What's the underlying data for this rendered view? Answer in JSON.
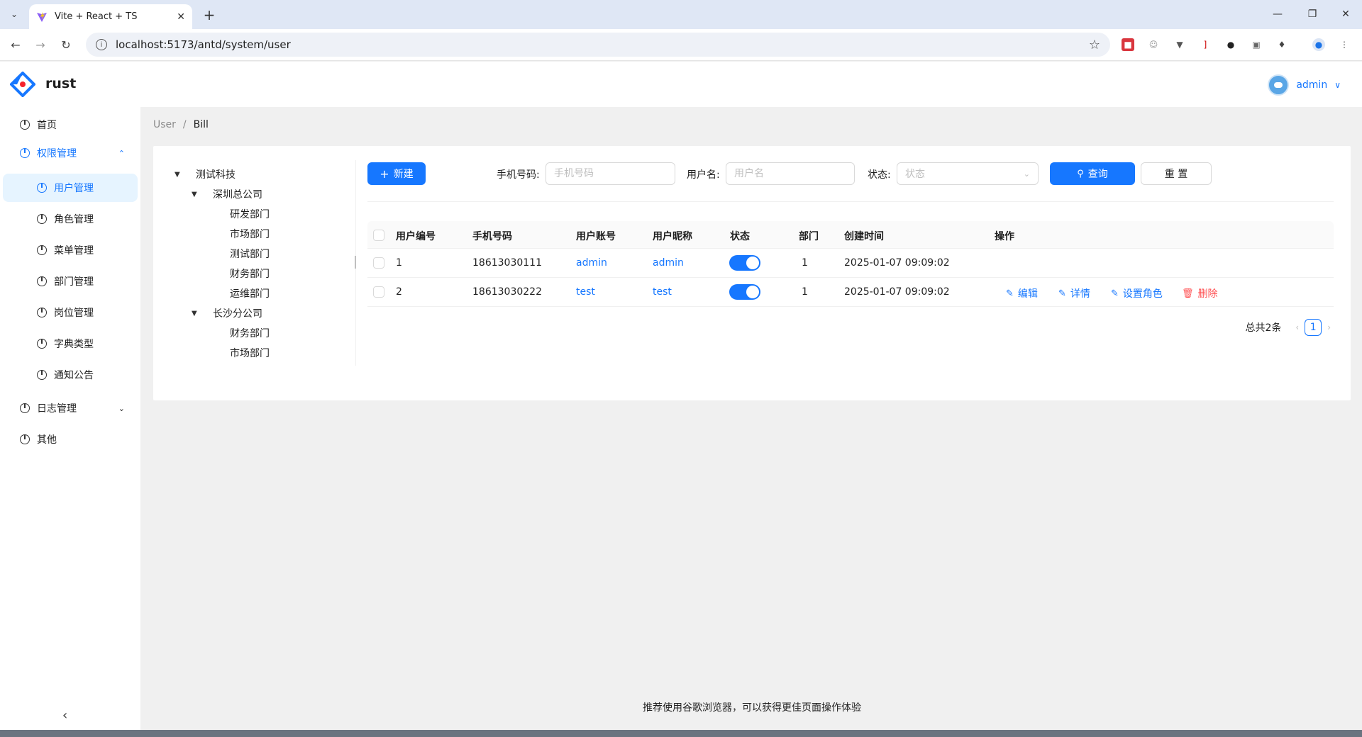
{
  "browser": {
    "tab_title": "Vite + React + TS",
    "url": "localhost:5173/antd/system/user"
  },
  "app": {
    "title": "rust",
    "user": "admin"
  },
  "sidebar": {
    "items": [
      {
        "label": "首页"
      },
      {
        "label": "权限管理"
      },
      {
        "label": "用户管理"
      },
      {
        "label": "角色管理"
      },
      {
        "label": "菜单管理"
      },
      {
        "label": "部门管理"
      },
      {
        "label": "岗位管理"
      },
      {
        "label": "字典类型"
      },
      {
        "label": "通知公告"
      },
      {
        "label": "日志管理"
      },
      {
        "label": "其他"
      }
    ]
  },
  "breadcrumb": {
    "parent": "User",
    "separator": "/",
    "current": "Bill"
  },
  "tree": {
    "nodes": [
      {
        "label": "测试科技"
      },
      {
        "label": "深圳总公司"
      },
      {
        "label": "研发部门"
      },
      {
        "label": "市场部门"
      },
      {
        "label": "测试部门"
      },
      {
        "label": "财务部门"
      },
      {
        "label": "运维部门"
      },
      {
        "label": "长沙分公司"
      },
      {
        "label": "财务部门"
      },
      {
        "label": "市场部门"
      }
    ]
  },
  "filters": {
    "new_label": "新建",
    "phone_label": "手机号码:",
    "phone_placeholder": "手机号码",
    "username_label": "用户名:",
    "username_placeholder": "用户名",
    "status_label": "状态:",
    "status_placeholder": "状态",
    "query_label": "查询",
    "reset_label": "重 置"
  },
  "table": {
    "columns": [
      "用户编号",
      "手机号码",
      "用户账号",
      "用户昵称",
      "状态",
      "部门",
      "创建时间",
      "操作"
    ],
    "rows": [
      {
        "id": "1",
        "phone": "18613030111",
        "account": "admin",
        "nickname": "admin",
        "status": true,
        "dept": "1",
        "created": "2025-01-07 09:09:02"
      },
      {
        "id": "2",
        "phone": "18613030222",
        "account": "test",
        "nickname": "test",
        "status": true,
        "dept": "1",
        "created": "2025-01-07 09:09:02"
      }
    ],
    "actions": {
      "edit": "编辑",
      "detail": "详情",
      "set_role": "设置角色",
      "delete": "删除"
    }
  },
  "pagination": {
    "total": "总共2条",
    "current": "1"
  },
  "footer": "推荐使用谷歌浏览器，可以获得更佳页面操作体验",
  "colors": {
    "primary": "#1677ff",
    "danger": "#ff4d4f"
  }
}
